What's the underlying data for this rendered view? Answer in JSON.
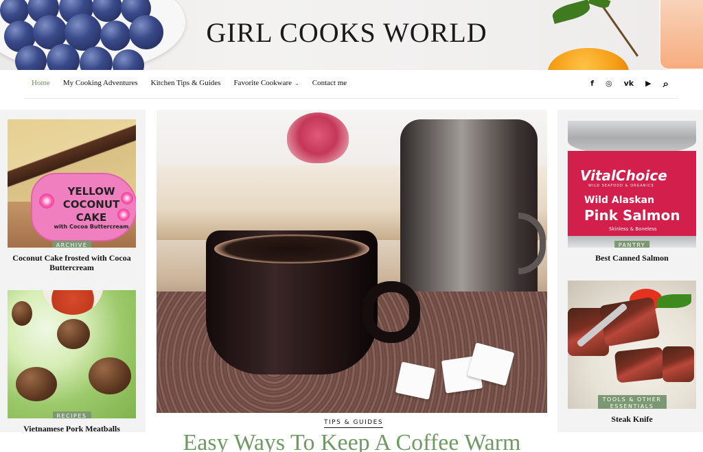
{
  "site": {
    "title": "GIRL COOKS WORLD"
  },
  "nav": {
    "items": [
      {
        "label": "Home",
        "active": true
      },
      {
        "label": "My Cooking Adventures"
      },
      {
        "label": "Kitchen Tips & Guides"
      },
      {
        "label": "Favorite Cookware",
        "has_dropdown": true
      },
      {
        "label": "Contact me"
      }
    ],
    "social_icons": [
      "facebook-icon",
      "instagram-icon",
      "vk-icon",
      "youtube-icon"
    ],
    "social_glyphs": [
      "f",
      "◎",
      "vk",
      "▶"
    ],
    "search_icon": "search-icon",
    "dropdown_glyph": "⌄",
    "search_glyph": "⌕"
  },
  "left_sidebar": {
    "cards": [
      {
        "category": "ARCHIVE",
        "title": "Coconut Cake frosted with Cocoa Buttercream",
        "image_text": {
          "line1": "YELLOW",
          "line2": "COCONUT",
          "line3": "CAKE",
          "line4": "with Cocoa Buttercream"
        }
      },
      {
        "category": "RECIPES",
        "title": "Vietnamese Pork Meatballs"
      }
    ]
  },
  "right_sidebar": {
    "cards": [
      {
        "category": "PANTRY",
        "title": "Best Canned Salmon",
        "image_text": {
          "brand": "VitalChoice",
          "tagline": "WILD SEAFOOD & ORGANICS",
          "line1": "Wild Alaskan",
          "line2": "Pink Salmon",
          "line3": "Skinless & Boneless"
        }
      },
      {
        "category": "TOOLS & OTHER ESSENTIALS",
        "title": "Steak Knife"
      }
    ]
  },
  "main": {
    "category": "TIPS & GUIDES",
    "title": "Easy Ways To Keep A Coffee Warm"
  },
  "colors": {
    "accent_green": "#6f9a64",
    "badge_green": "#7c9872",
    "nav_active": "#6b8f5e"
  }
}
